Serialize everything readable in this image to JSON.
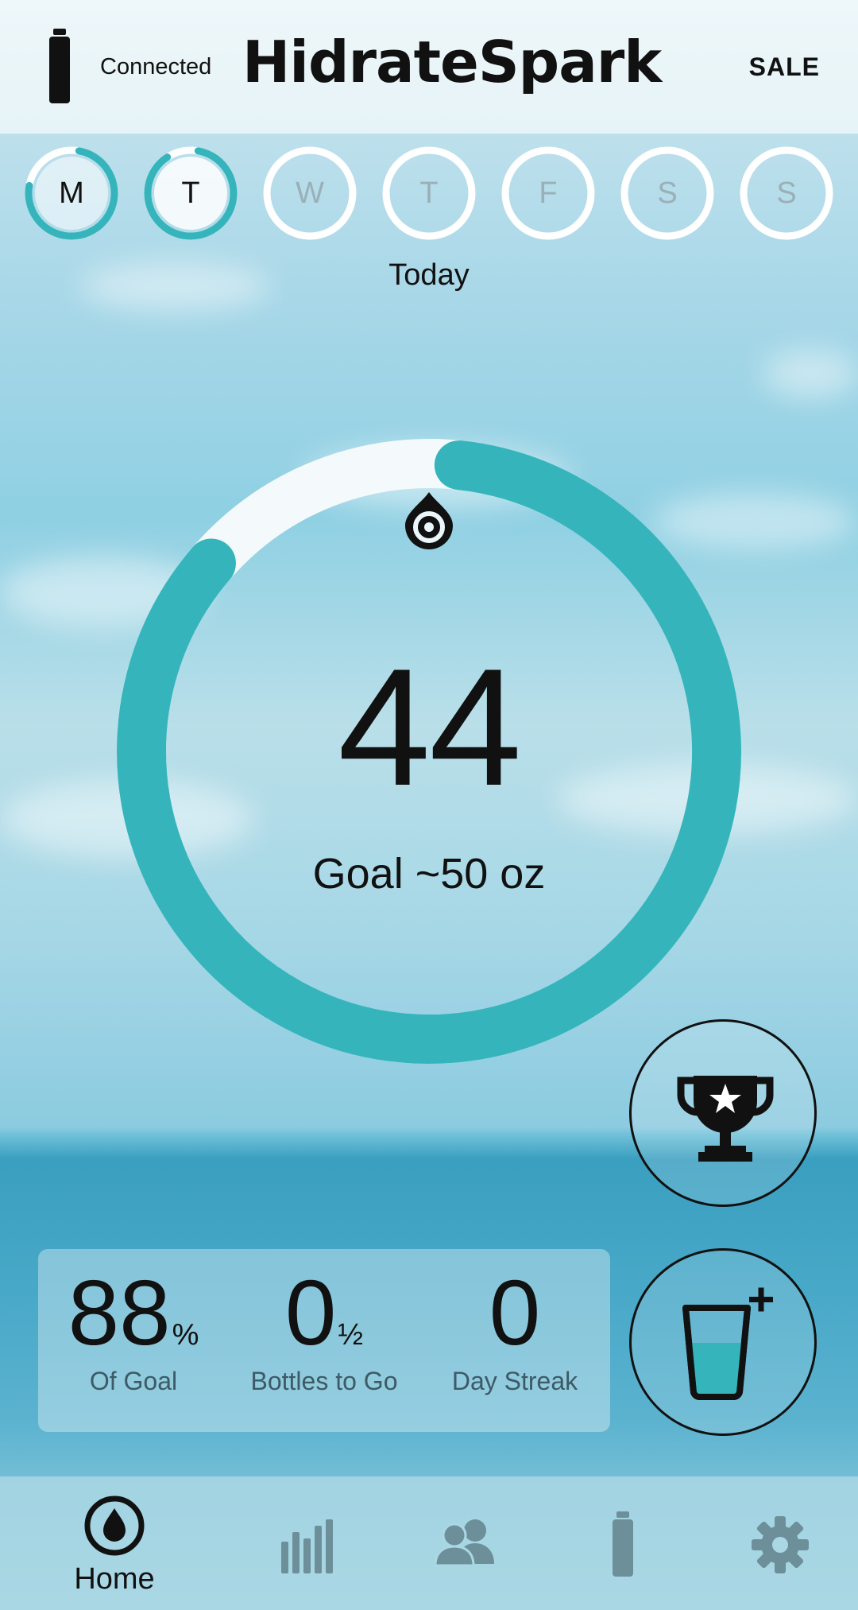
{
  "header": {
    "status": "Connected",
    "brand": "HidrateSpark",
    "sale": "SALE"
  },
  "week": {
    "days": [
      {
        "label": "M",
        "progress": 0.75
      },
      {
        "label": "T",
        "progress": 0.88
      },
      {
        "label": "W",
        "progress": 0
      },
      {
        "label": "T",
        "progress": 0
      },
      {
        "label": "F",
        "progress": 0
      },
      {
        "label": "S",
        "progress": 0
      },
      {
        "label": "S",
        "progress": 0
      }
    ],
    "selected_caption": "Today"
  },
  "progress": {
    "amount": "44",
    "goal_text": "Goal ~50 oz",
    "fraction": 0.88
  },
  "stats": {
    "of_goal_value": "88",
    "of_goal_suffix": "%",
    "of_goal_label": "Of Goal",
    "bottles_value": "0",
    "bottles_suffix": "½",
    "bottles_label": "Bottles to Go",
    "streak_value": "0",
    "streak_label": "Day Streak"
  },
  "nav": {
    "items": [
      {
        "icon": "drop-icon",
        "label": "Home",
        "active": true
      },
      {
        "icon": "bar-chart-icon",
        "label": "",
        "active": false
      },
      {
        "icon": "friends-icon",
        "label": "",
        "active": false
      },
      {
        "icon": "bottle-icon",
        "label": "",
        "active": false
      },
      {
        "icon": "gear-icon",
        "label": "",
        "active": false
      }
    ]
  },
  "colors": {
    "accent": "#35b5bb",
    "track": "#f4fafc",
    "inactive_icon": "#6d8f99"
  }
}
